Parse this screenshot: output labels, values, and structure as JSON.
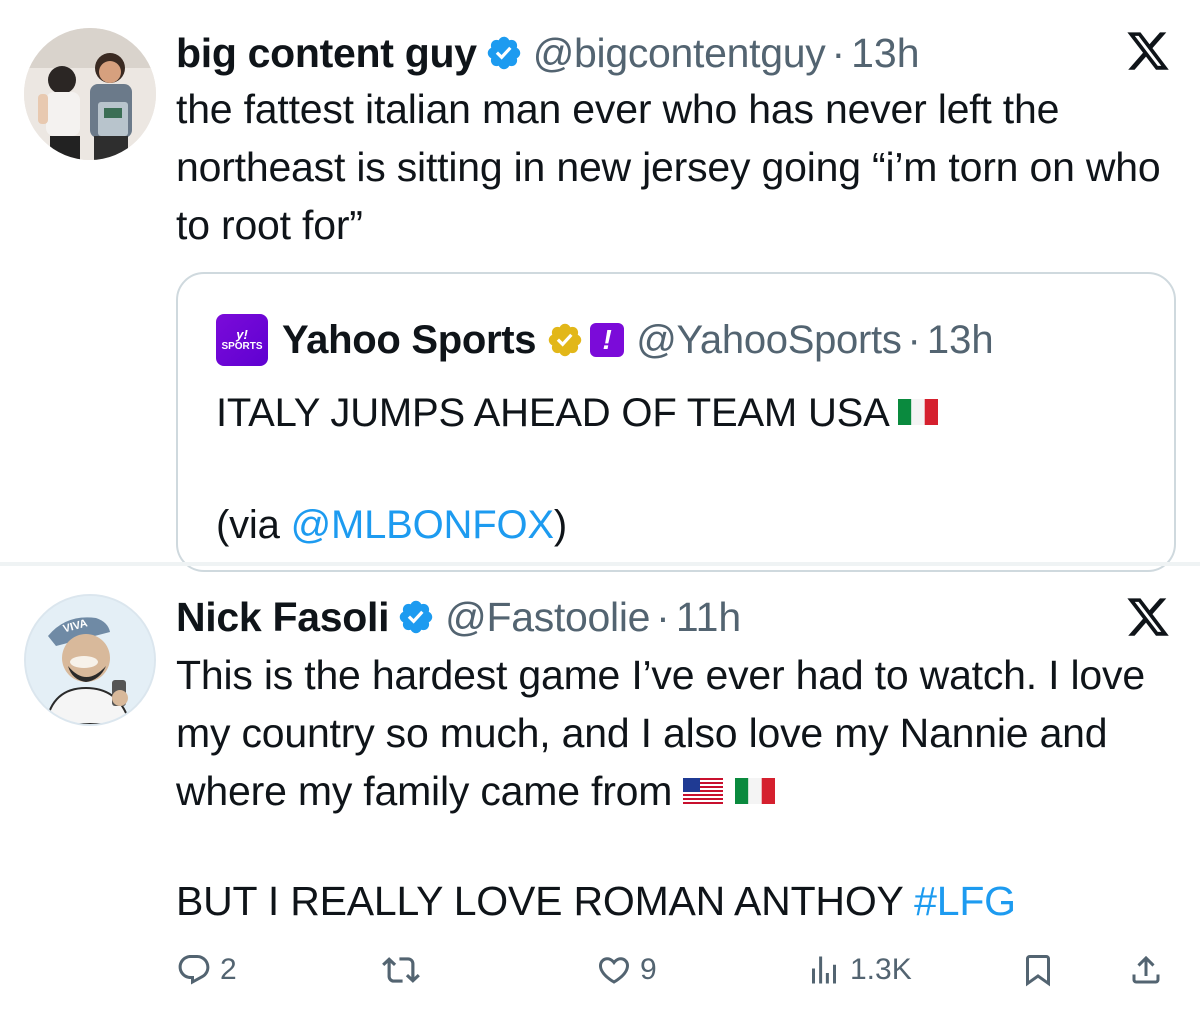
{
  "tweets": [
    {
      "author_name": "big content guy",
      "handle": "@bigcontentguy",
      "separator": "·",
      "time": "13h",
      "verified_icon": "verified-badge-icon",
      "text": "the fattest italian man ever who has never left the northeast is sitting in new jersey going “i’m torn on who to root for”"
    },
    {
      "author_name": "Nick Fasoli",
      "handle": "@Fastoolie",
      "separator": "·",
      "time": "11h",
      "verified_icon": "verified-badge-icon",
      "text": "This is the hardest game I’ve ever had to watch. I love my country so much, and I also love my Nannie and where my family came from",
      "text2": "BUT I REALLY LOVE ROMAN ANTHOY ",
      "hashtag": "#LFG",
      "stats": {
        "replies": "2",
        "retweets": "",
        "likes": "9",
        "views": "1.3K"
      }
    }
  ],
  "quote": {
    "logo_text_top": "y!",
    "logo_text_bottom": "SPORTS",
    "author_name": "Yahoo Sports",
    "affiliate_badge": "!",
    "handle": "@YahooSports",
    "separator": "·",
    "time": "13h",
    "text": "ITALY JUMPS AHEAD OF TEAM USA",
    "via_prefix": "(via ",
    "via_mention": "@MLBONFOX",
    "via_suffix": ")"
  },
  "colors": {
    "accent": "#1d9bf0",
    "secondary_text": "#536471",
    "border": "#cfd9de",
    "gold_badge": "#e2b719",
    "yahoo_purple": "#7b0bd9"
  },
  "icons": [
    "x-logo-icon",
    "verified-badge-icon",
    "gold-verified-icon",
    "italy-flag-icon",
    "us-flag-icon",
    "reply-icon",
    "retweet-icon",
    "like-icon",
    "views-icon",
    "bookmark-icon",
    "share-icon"
  ]
}
